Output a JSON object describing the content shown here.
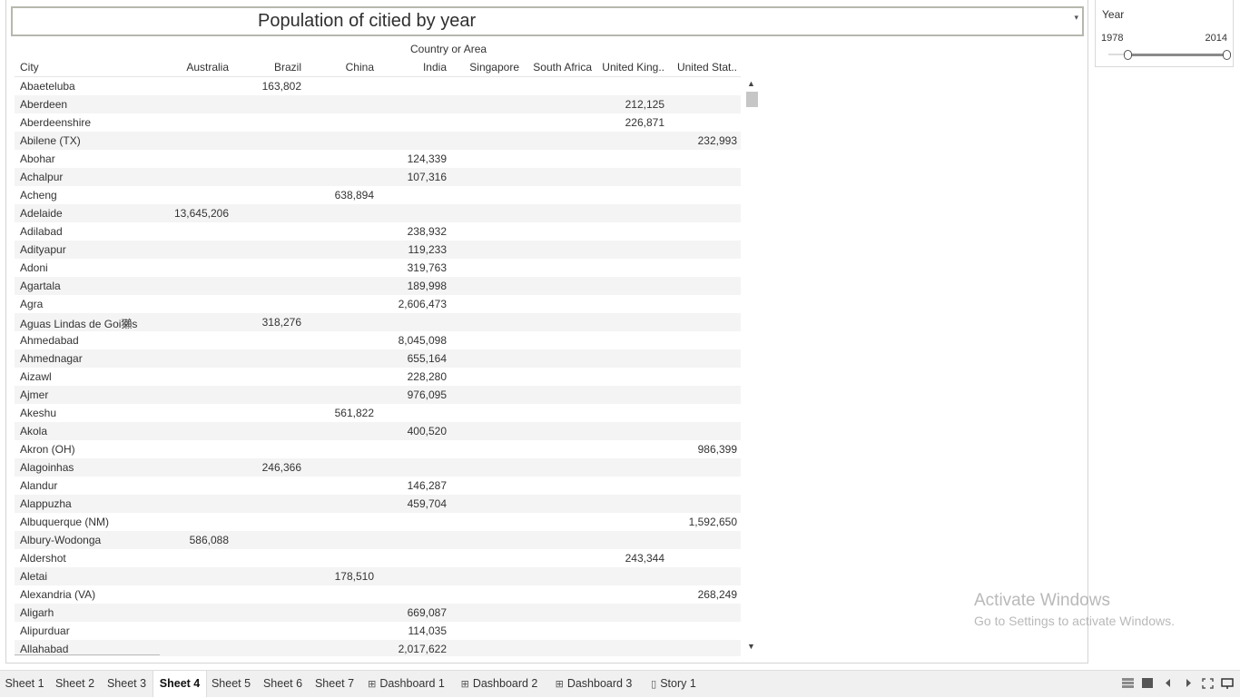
{
  "sheet": {
    "title": "Population of citied by year",
    "column_group_label": "Country or Area",
    "columns": [
      "City",
      "Australia",
      "Brazil",
      "China",
      "India",
      "Singapore",
      "South Africa",
      "United King..",
      "United Stat.."
    ],
    "rows": [
      {
        "city": "Abaeteluba",
        "brazil": "163,802"
      },
      {
        "city": "Aberdeen",
        "united_kingdom": "212,125"
      },
      {
        "city": "Aberdeenshire",
        "united_kingdom": "226,871"
      },
      {
        "city": "Abilene (TX)",
        "united_states": "232,993"
      },
      {
        "city": "Abohar",
        "india": "124,339"
      },
      {
        "city": "Achalpur",
        "india": "107,316"
      },
      {
        "city": "Acheng",
        "china": "638,894"
      },
      {
        "city": "Adelaide",
        "australia": "13,645,206"
      },
      {
        "city": "Adilabad",
        "india": "238,932"
      },
      {
        "city": "Adityapur",
        "india": "119,233"
      },
      {
        "city": "Adoni",
        "india": "319,763"
      },
      {
        "city": "Agartala",
        "india": "189,998"
      },
      {
        "city": "Agra",
        "india": "2,606,473"
      },
      {
        "city": "Aguas Lindas de Goi獺s",
        "brazil": "318,276"
      },
      {
        "city": "Ahmedabad",
        "india": "8,045,098"
      },
      {
        "city": "Ahmednagar",
        "india": "655,164"
      },
      {
        "city": "Aizawl",
        "india": "228,280"
      },
      {
        "city": "Ajmer",
        "india": "976,095"
      },
      {
        "city": "Akeshu",
        "china": "561,822"
      },
      {
        "city": "Akola",
        "india": "400,520"
      },
      {
        "city": "Akron (OH)",
        "united_states": "986,399"
      },
      {
        "city": "Alagoinhas",
        "brazil": "246,366"
      },
      {
        "city": "Alandur",
        "india": "146,287"
      },
      {
        "city": "Alappuzha",
        "india": "459,704"
      },
      {
        "city": "Albuquerque (NM)",
        "united_states": "1,592,650"
      },
      {
        "city": "Albury-Wodonga",
        "australia": "586,088"
      },
      {
        "city": "Aldershot",
        "united_kingdom": "243,344"
      },
      {
        "city": "Aletai",
        "china": "178,510"
      },
      {
        "city": "Alexandria (VA)",
        "united_states": "268,249"
      },
      {
        "city": "Aligarh",
        "india": "669,087"
      },
      {
        "city": "Alipurduar",
        "india": "114,035"
      },
      {
        "city": "Allahabad",
        "india": "2,017,622"
      }
    ]
  },
  "filter": {
    "title": "Year",
    "min_label": "1978",
    "max_label": "2014",
    "range": [
      1978,
      2014
    ]
  },
  "watermark": {
    "title": "Activate Windows",
    "subtitle": "Go to Settings to activate Windows."
  },
  "tabs": [
    {
      "label": "Sheet 1",
      "icon": "",
      "active": false
    },
    {
      "label": "Sheet 2",
      "icon": "",
      "active": false
    },
    {
      "label": "Sheet 3",
      "icon": "",
      "active": false
    },
    {
      "label": "Sheet 4",
      "icon": "",
      "active": true
    },
    {
      "label": "Sheet 5",
      "icon": "",
      "active": false
    },
    {
      "label": "Sheet 6",
      "icon": "",
      "active": false
    },
    {
      "label": "Sheet 7",
      "icon": "",
      "active": false
    },
    {
      "label": "Dashboard 1",
      "icon": "dashboard-icon",
      "active": false
    },
    {
      "label": "Dashboard 2",
      "icon": "dashboard-icon",
      "active": false
    },
    {
      "label": "Dashboard 3",
      "icon": "dashboard-icon",
      "active": false
    },
    {
      "label": "Story 1",
      "icon": "story-icon",
      "active": false
    }
  ],
  "nav_icons": [
    "sheet-sorter-icon",
    "filmstrip-icon",
    "previous-sheet-icon",
    "next-sheet-icon",
    "fullscreen-icon",
    "presentation-icon"
  ],
  "glyphs": {
    "dropdown": "▾",
    "scroll_up": "▲",
    "scroll_down": "▼",
    "dashboard": "⊞",
    "story": "▯"
  }
}
